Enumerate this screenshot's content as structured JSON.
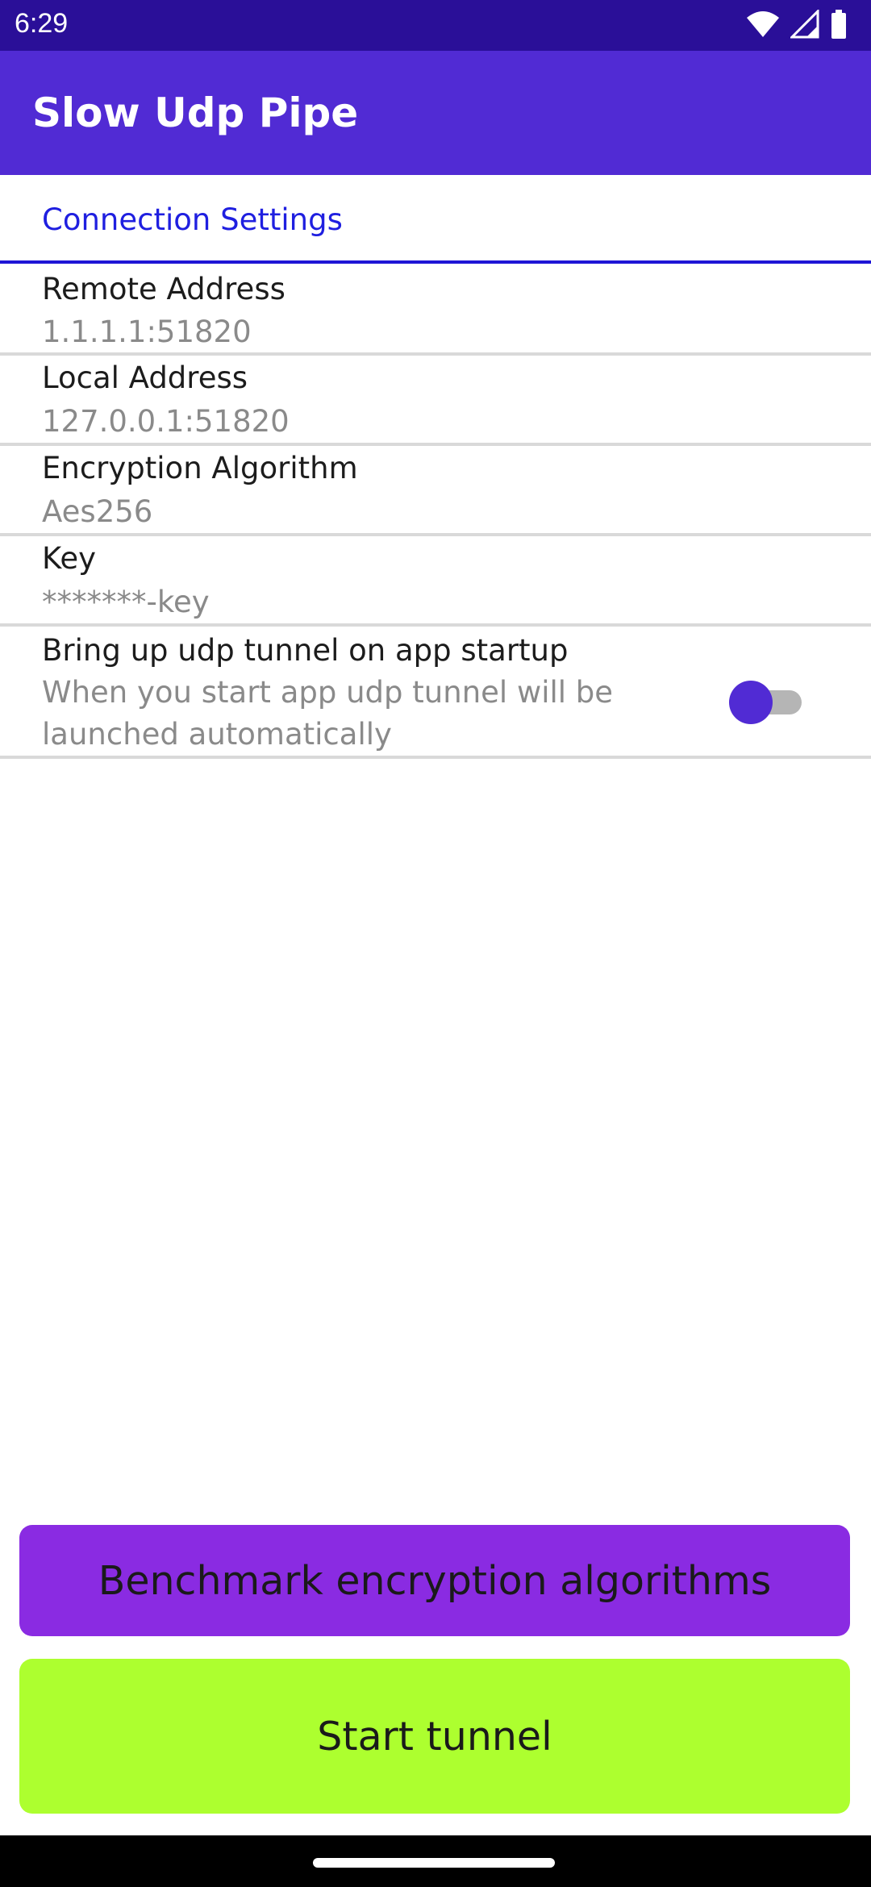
{
  "status_bar": {
    "time": "6:29",
    "icons": [
      "wifi-icon",
      "cell-signal-icon",
      "battery-icon"
    ]
  },
  "app_bar": {
    "title": "Slow Udp Pipe",
    "color": "#512bd4"
  },
  "section": {
    "title": "Connection Settings"
  },
  "settings": [
    {
      "title": "Remote Address",
      "value": "1.1.1.1:51820"
    },
    {
      "title": "Local Address",
      "value": "127.0.0.1:51820"
    },
    {
      "title": "Encryption Algorithm",
      "value": "Aes256"
    },
    {
      "title": "Key",
      "value": "*******-key"
    }
  ],
  "startup_toggle": {
    "title": "Bring up udp tunnel on app startup",
    "description": "When you start app udp tunnel will be launched automatically",
    "state": "off"
  },
  "buttons": {
    "benchmark_label": "Benchmark encryption algorithms",
    "benchmark_color": "#8a2be2",
    "start_label": "Start tunnel",
    "start_color": "#adff2f"
  }
}
